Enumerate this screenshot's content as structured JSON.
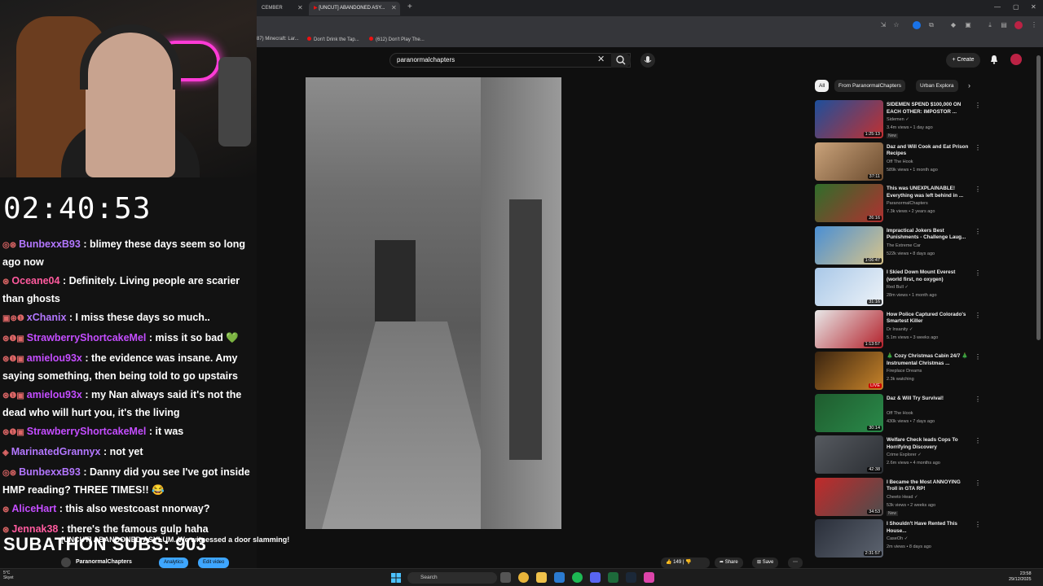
{
  "stream": {
    "timer": "02:40:53",
    "subathon": "SUBATHON SUBS: 903",
    "chat": [
      {
        "user": "BunbexxB93",
        "user_color": "#b377ff",
        "badges": "◎⊛",
        "text": " : blimey these days seem so long ago now"
      },
      {
        "user": "Oceane04",
        "user_color": "#ff5a9e",
        "badges": "⊛",
        "text": " : Definitely. Living people are scarier than ghosts"
      },
      {
        "user": "xChanix",
        "user_color": "#b377ff",
        "badges": "▣⊛❶",
        "text": " : I miss these days so much.."
      },
      {
        "user": "StrawberryShortcakeMel",
        "user_color": "#c44dff",
        "badges": "⊛❶▣",
        "text": " : miss it so bad 💚"
      },
      {
        "user": "amielou93x",
        "user_color": "#c44dff",
        "badges": "⊛❶▣",
        "text": " : the evidence was insane. Amy saying something, then being told to go upstairs"
      },
      {
        "user": "amielou93x",
        "user_color": "#c44dff",
        "badges": "⊛❶▣",
        "text": " : my Nan always said it's not the dead who will hurt you, it's the living"
      },
      {
        "user": "StrawberryShortcakeMel",
        "user_color": "#c44dff",
        "badges": "⊛❶▣",
        "text": " : it was"
      },
      {
        "user": "MarinatedGrannyx",
        "user_color": "#b377ff",
        "badges": "◈",
        "text": " : not yet"
      },
      {
        "user": "BunbexxB93",
        "user_color": "#b377ff",
        "badges": "◎⊛",
        "text": " : Danny did you see I've got inside HMP reading? THREE TIMES!! 😂"
      },
      {
        "user": "AliceHart",
        "user_color": "#c44dff",
        "badges": "⊛",
        "text": " : this also westcoast nnorway?"
      },
      {
        "user": "Jennak38",
        "user_color": "#ff5a9e",
        "badges": "⊛",
        "text": " : there's the famous gulp haha"
      }
    ]
  },
  "browser": {
    "tabs": [
      {
        "label": "CEMBER"
      },
      {
        "label": "[UNCUT] ABANDONED ASY..."
      }
    ],
    "bookmarks": [
      {
        "label": "87) Minecraft: Lar..."
      },
      {
        "label": "Don't Drink the Tap..."
      },
      {
        "label": "(612) Don't Play The..."
      }
    ]
  },
  "youtube": {
    "search_value": "paranormalchapters",
    "create_label": "Create",
    "video_title": "[UNCUT] ABANDONED ASYLUM. We witnessed a door slamming!",
    "channel_name": "ParanormalChapters",
    "analytics_label": "Analytics",
    "edit_label": "Edit video",
    "like_count": "149",
    "share_label": "Share",
    "save_label": "Save",
    "chips": [
      "All",
      "From ParanormalChapters",
      "Urban Explora"
    ],
    "recommendations": [
      {
        "title": "SIDEMEN SPEND $100,000 ON EACH OTHER: IMPOSTOR ...",
        "channel": "Sidemen ✓",
        "meta": "3.4m views • 1 day ago",
        "badge": "New",
        "duration": "1:25:13",
        "thumb": [
          "#1d4f9c",
          "#c23030"
        ]
      },
      {
        "title": "Daz and Will Cook and Eat Prison Recipes",
        "channel": "Off The Hook",
        "meta": "589k views • 1 month ago",
        "badge": "",
        "duration": "37:11",
        "thumb": [
          "#c9a27a",
          "#6b4b2e"
        ]
      },
      {
        "title": "This was UNEXPLAINABLE! Everything was left behind in ...",
        "channel": "ParanormalChapters",
        "meta": "7.3k views • 2 years ago",
        "badge": "",
        "duration": "26:16",
        "thumb": [
          "#2f6e2a",
          "#b03030"
        ]
      },
      {
        "title": "Impractical Jokers Best Punishments - Challenge Laug...",
        "channel": "The Extreme Car",
        "meta": "522k views • 8 days ago",
        "badge": "",
        "duration": "1:06:47",
        "thumb": [
          "#4a8fd4",
          "#d8c48a"
        ]
      },
      {
        "title": "I Skied Down Mount Everest (world first, no oxygen)",
        "channel": "Red Bull ✓",
        "meta": "28m views • 1 month ago",
        "badge": "",
        "duration": "31:16",
        "thumb": [
          "#a9c8e8",
          "#eef3f8"
        ]
      },
      {
        "title": "How Police Captured Colorado's Smartest Killer",
        "channel": "Dr Insanity ✓",
        "meta": "5.1m views • 3 weeks ago",
        "badge": "",
        "duration": "1:13:57",
        "thumb": [
          "#e8e8e8",
          "#b3202a"
        ]
      },
      {
        "title": "🎄 Cozy Christmas Cabin 24/7 🎄 Instrumental Christmas ...",
        "channel": "Fireplace Dreams",
        "meta": "2.3k watching",
        "badge": "",
        "duration": "LIVE",
        "thumb": [
          "#3a2410",
          "#c8842a"
        ]
      },
      {
        "title": "Daz & Will Try Survival!",
        "channel": "Off The Hook",
        "meta": "430k views • 7 days ago",
        "badge": "",
        "duration": "30:14",
        "thumb": [
          "#1f5c2e",
          "#2a8a4a"
        ]
      },
      {
        "title": "Welfare Check leads Cops To Horrifying Discovery",
        "channel": "Crime Explorer ✓",
        "meta": "2.6m views • 4 months ago",
        "badge": "",
        "duration": "42:38",
        "thumb": [
          "#565a60",
          "#2b2e33"
        ]
      },
      {
        "title": "I Became the Most ANNOYING Troll in GTA RP!",
        "channel": "Cheeto Head ✓",
        "meta": "53k views • 2 weeks ago",
        "badge": "New",
        "duration": "34:53",
        "thumb": [
          "#c22a2a",
          "#4d4d4d"
        ]
      },
      {
        "title": "I Shouldn't Have Rented This House...",
        "channel": "CaseOh ✓",
        "meta": "2m views • 8 days ago",
        "badge": "",
        "duration": "2:31:57",
        "thumb": [
          "#2a2f3a",
          "#5d6470"
        ]
      }
    ]
  },
  "taskbar": {
    "weather_temp": "5°C",
    "weather_desc": "Skyet",
    "search_placeholder": "Search",
    "time": "23:58",
    "date": "29/12/2025"
  }
}
